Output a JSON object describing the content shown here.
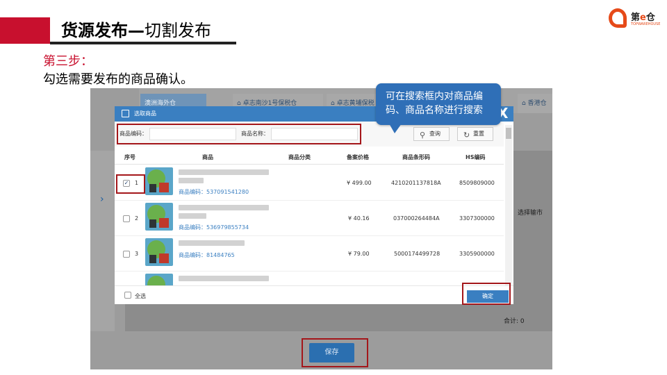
{
  "slide": {
    "title_bold": "货源发布—",
    "title_rest": "切割发布",
    "step_label": "第三步：",
    "description": "勾选需要发布的商品确认。"
  },
  "logo": {
    "name_part1": "第",
    "name_e": "e",
    "name_part2": "仓",
    "subtitle": "TOPWAREHOUSE"
  },
  "background_ui": {
    "tabs": [
      "澳洲海外仓",
      "卓志南沙1号保税仓",
      "卓志黄埔保税",
      "香港仓"
    ],
    "choose_port": "选择输市",
    "total": "合计: 0",
    "save_button": "保存"
  },
  "dialog": {
    "title": "选取商品",
    "close": "X",
    "search": {
      "code_label": "商品编码：",
      "name_label": "商品名称：",
      "query_button": "查询",
      "reset_button": "重置"
    },
    "columns": [
      "序号",
      "商品",
      "商品分类",
      "备案价格",
      "商品条形码",
      "HS编码"
    ],
    "rows": [
      {
        "index": "1",
        "checked": true,
        "code": "商品编码：537091541280",
        "price": "¥ 499.00",
        "barcode": "4210201137818A",
        "hs": "8509809000"
      },
      {
        "index": "2",
        "checked": false,
        "code": "商品编码：536979855734",
        "price": "¥ 40.16",
        "barcode": "037000264484A",
        "hs": "3307300000"
      },
      {
        "index": "3",
        "checked": false,
        "code": "商品编码：81484765",
        "price": "¥ 79.00",
        "barcode": "5000174499728",
        "hs": "3305900000"
      }
    ],
    "select_all": "全选",
    "confirm_button": "确定"
  },
  "callout": {
    "text": "可在搜索框内对商品编码、商品名称进行搜索"
  },
  "colors": {
    "accent_red": "#c8102e",
    "dialog_blue": "#3a7fc1",
    "callout_blue": "#2f6fb7",
    "highlight_box": "#a4161a"
  }
}
